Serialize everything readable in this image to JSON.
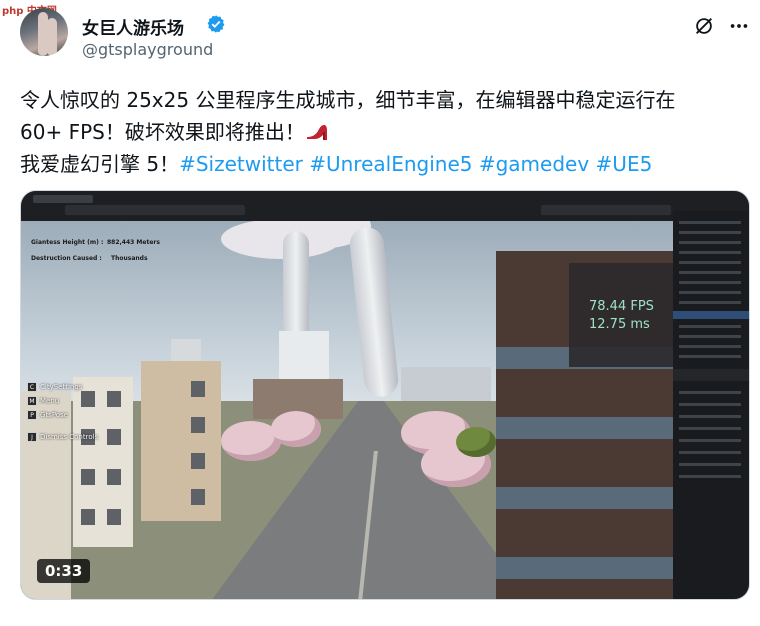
{
  "watermark": "php 中文网",
  "author": {
    "name": "女巨人游乐场",
    "handle": "@gtsplayground"
  },
  "tweet": {
    "line1": "令人惊叹的 25x25 公里程序生成城市，细节丰富，在编辑器中稳定运行在",
    "line2_text": "60+ FPS！破坏效果即将推出！",
    "line3_text": "我爱虚幻引擎 5！",
    "hashtags": [
      "#Sizetwitter",
      "#UnrealEngine5",
      "#gamedev",
      "#UE5"
    ]
  },
  "video": {
    "duration": "0:33",
    "hud": {
      "height_label": "Giantess Height (m) :",
      "height_value": "882,443  Meters",
      "destruction_label": "Destruction Caused :",
      "destruction_value": "Thousands"
    },
    "stats": {
      "fps": "78.44 FPS",
      "ms": "12.75 ms"
    },
    "menu": [
      {
        "key": "C",
        "label": "CitySettings"
      },
      {
        "key": "M",
        "label": "Menu"
      },
      {
        "key": "P",
        "label": "GtsPose"
      },
      {
        "key": "J",
        "label": "Dismiss Controls"
      }
    ]
  },
  "colors": {
    "hashtag": "#1d9bf0",
    "verified": "#1d9bf0",
    "fps_text": "#9fe3c4"
  },
  "icons": [
    "verified-badge-icon",
    "grok-icon",
    "more-icon",
    "high-heel-emoji"
  ]
}
